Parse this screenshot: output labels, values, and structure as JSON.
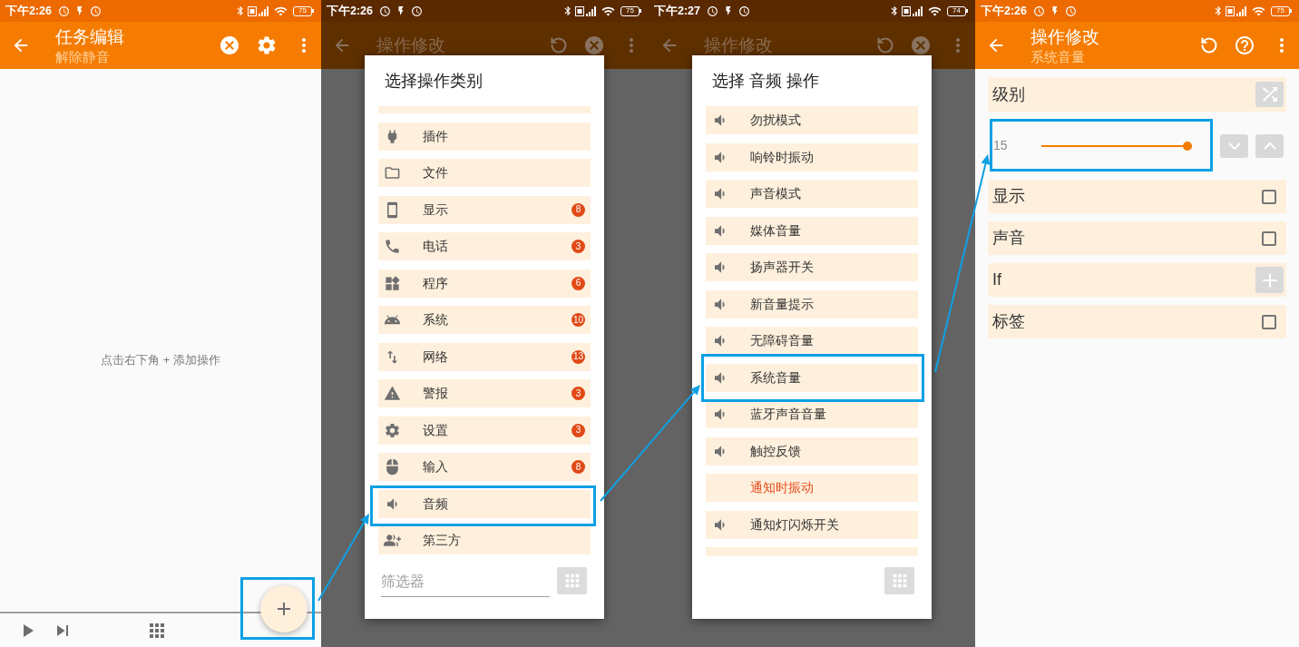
{
  "screens": [
    {
      "kind": "task_editor",
      "status_bar": {
        "time": "下午2:26",
        "battery": "75"
      },
      "app_bar": {
        "title": "任务编辑",
        "subtitle": "解除静音",
        "actions": [
          {
            "kind": "close"
          },
          {
            "kind": "settings"
          },
          {
            "kind": "more"
          }
        ]
      },
      "empty_hint": "点击右下角 + 添加操作"
    },
    {
      "kind": "picker",
      "status_bar": {
        "time": "下午2:26",
        "battery": "75"
      },
      "app_bar": {
        "title": "操作修改",
        "actions": [
          {
            "kind": "reset"
          },
          {
            "kind": "close"
          },
          {
            "kind": "more"
          }
        ]
      },
      "dialog": {
        "title": "选择操作类别",
        "partial_item_above": true,
        "items": [
          {
            "kind": "plugin",
            "label": "插件"
          },
          {
            "kind": "file",
            "label": "文件"
          },
          {
            "kind": "display",
            "label": "显示",
            "badge": "8"
          },
          {
            "kind": "phone",
            "label": "电话",
            "badge": "3"
          },
          {
            "kind": "app",
            "label": "程序",
            "badge": "6"
          },
          {
            "kind": "system",
            "label": "系统",
            "badge": "10"
          },
          {
            "kind": "network",
            "label": "网络",
            "badge": "13"
          },
          {
            "kind": "alert",
            "label": "警报",
            "badge": "3"
          },
          {
            "kind": "settings",
            "label": "设置",
            "badge": "3"
          },
          {
            "kind": "input",
            "label": "输入",
            "badge": "8"
          },
          {
            "kind": "audio",
            "label": "音频"
          },
          {
            "kind": "third_party",
            "label": "第三方"
          }
        ],
        "filter": {
          "placeholder": "筛选器"
        }
      }
    },
    {
      "kind": "picker",
      "status_bar": {
        "time": "下午2:27",
        "battery": "74"
      },
      "app_bar": {
        "title": "操作修改",
        "actions": [
          {
            "kind": "reset"
          },
          {
            "kind": "close"
          },
          {
            "kind": "more"
          }
        ]
      },
      "dialog": {
        "title": "选择 音频 操作",
        "partial_item_below": true,
        "items": [
          {
            "kind": "audio",
            "label": "勿扰模式"
          },
          {
            "kind": "audio",
            "label": "响铃时振动"
          },
          {
            "kind": "audio",
            "label": "声音模式"
          },
          {
            "kind": "audio",
            "label": "媒体音量"
          },
          {
            "kind": "audio",
            "label": "扬声器开关"
          },
          {
            "kind": "audio",
            "label": "新音量提示"
          },
          {
            "kind": "audio",
            "label": "无障碍音量"
          },
          {
            "kind": "audio",
            "label": "系统音量"
          },
          {
            "kind": "audio",
            "label": "蓝牙声音音量"
          },
          {
            "kind": "audio",
            "label": "触控反馈"
          },
          {
            "kind": "unsupported",
            "label": "通知时振动"
          },
          {
            "kind": "audio",
            "label": "通知灯闪烁开关"
          }
        ]
      }
    },
    {
      "kind": "action_editor",
      "status_bar": {
        "time": "下午2:26",
        "battery": "75"
      },
      "app_bar": {
        "title": "操作修改",
        "subtitle": "系统音量",
        "actions": [
          {
            "kind": "reset"
          },
          {
            "kind": "help"
          },
          {
            "kind": "more"
          }
        ]
      },
      "fields": [
        {
          "kind": "header",
          "label": "级别"
        },
        {
          "kind": "slider",
          "value": "15",
          "level": 1
        },
        {
          "kind": "checkbox",
          "label": "显示",
          "checked": false
        },
        {
          "kind": "checkbox",
          "label": "声音",
          "checked": false
        },
        {
          "kind": "add",
          "label": "If"
        },
        {
          "kind": "checkbox",
          "label": "标签",
          "checked": false
        }
      ]
    }
  ]
}
